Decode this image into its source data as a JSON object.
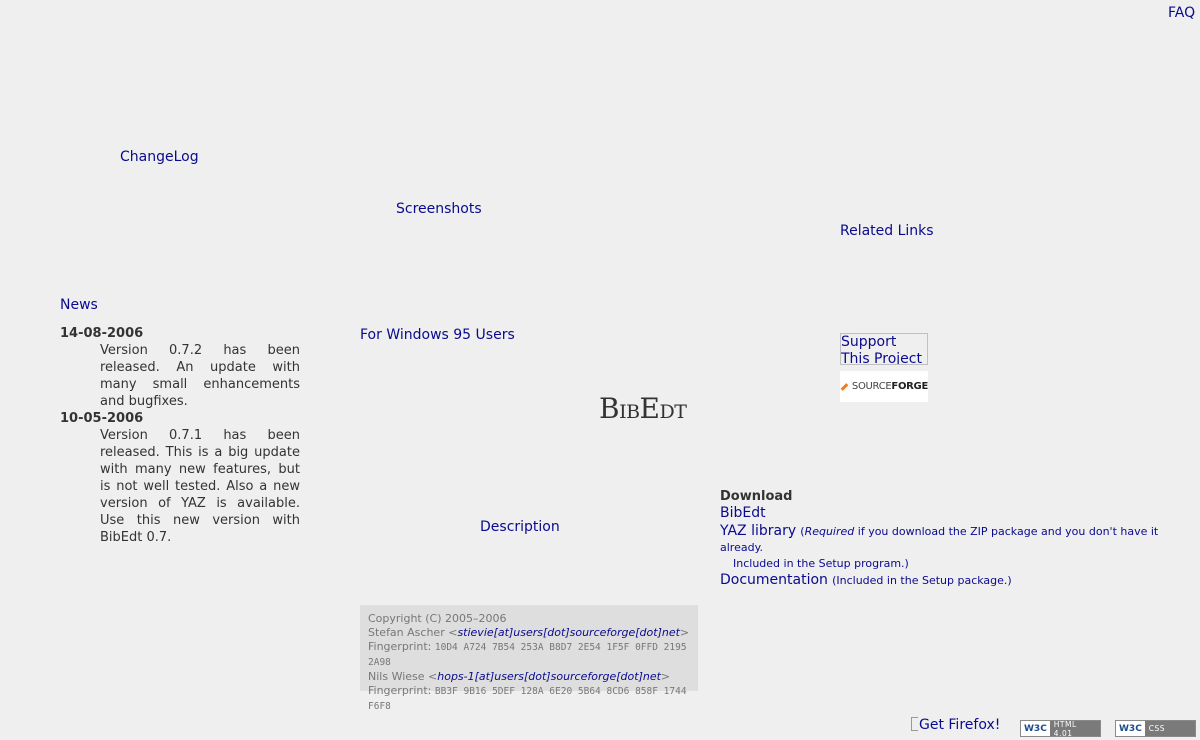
{
  "nav": {
    "faq": "FAQ",
    "changelog": "ChangeLog",
    "screenshots": "Screenshots",
    "related_links": "Related Links",
    "windows95": "For Windows 95 Users",
    "description": "Description"
  },
  "news": {
    "heading": "News",
    "items": [
      {
        "date": "14-08-2006",
        "text": "Version 0.7.2 has been released. An update with many small enhancements and bugfixes."
      },
      {
        "date": "10-05-2006",
        "text": "Version 0.7.1 has been released. This is a big update with many new features, but is not well tested. Also a new version of YAZ is available. Use this new version with BibEdt 0.7."
      }
    ]
  },
  "logo": {
    "first": "B",
    "part1": "IB",
    "mid": "E",
    "part2": "DT"
  },
  "badges": {
    "support": "Support This Project",
    "sourceforge_a": "SOURCE",
    "sourceforge_b": "FORGE"
  },
  "download": {
    "heading": "Download",
    "bibedt": "BibEdt",
    "yaz": "YAZ library",
    "yaz_note_italic": "Required",
    "yaz_note_rest": " if you download the ZIP package and you don't have it already.",
    "yaz_note_line2": "Included in the Setup program.)",
    "docs": "Documentation",
    "docs_note": "(Included in the Setup package.)"
  },
  "copyright": {
    "line1": "Copyright (C) 2005–2006",
    "author1": "Stefan Ascher",
    "email1": "stievie[at]users[dot]sourceforge[dot]net",
    "fp_label": "Fingerprint:",
    "fp1": "10D4 A724 7B54 253A B8D7 2E54 1F5F 0FFD 2195 2A98",
    "author2": "Nils Wiese",
    "email2": "hops-1[at]users[dot]sourceforge[dot]net",
    "fp2": "BB3F 9B16 5DEF 128A 6E20 5B64 8CD6 858F 1744 F6F8"
  },
  "footer": {
    "firefox": "Get Firefox!",
    "w3c_html": "HTML 4.01",
    "w3c_css": "CSS",
    "w3c_mark": "W3C"
  },
  "colors": {
    "link": "#0a0a8f",
    "background": "#efefef",
    "text": "#333333",
    "box": "#dedede"
  }
}
